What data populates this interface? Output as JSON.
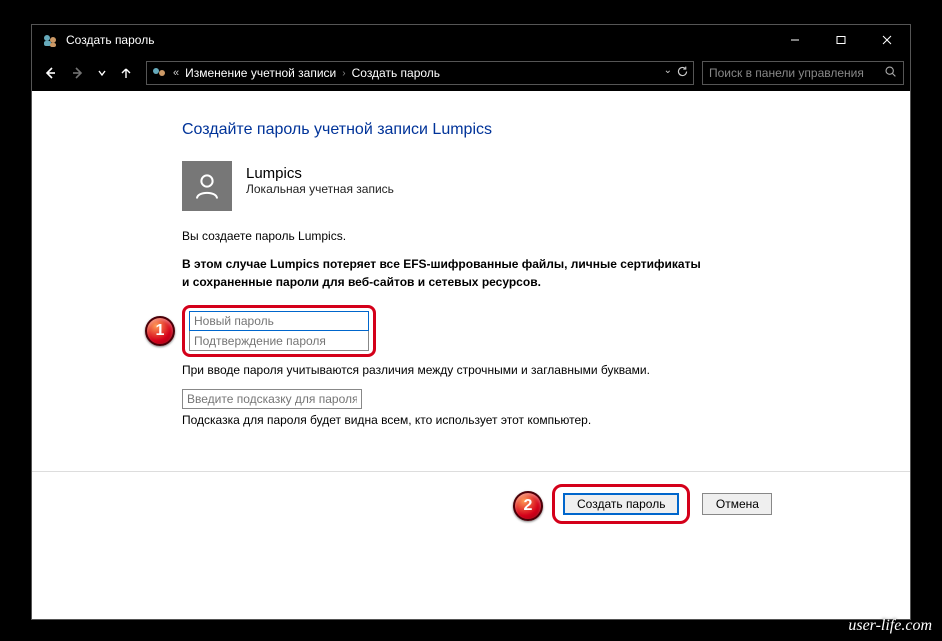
{
  "window": {
    "title": "Создать пароль"
  },
  "breadcrumb": {
    "item1": "Изменение учетной записи",
    "item2": "Создать пароль"
  },
  "search": {
    "placeholder": "Поиск в панели управления"
  },
  "page": {
    "heading": "Создайте пароль учетной записи Lumpics",
    "user_name": "Lumpics",
    "user_type": "Локальная учетная запись",
    "info": "Вы создаете пароль Lumpics.",
    "warning": "В этом случае Lumpics потеряет все EFS-шифрованные файлы, личные сертификаты и сохраненные пароли для веб-сайтов и сетевых ресурсов.",
    "new_password_placeholder": "Новый пароль",
    "confirm_password_placeholder": "Подтверждение пароля",
    "case_note": "При вводе пароля учитываются различия между строчными и заглавными буквами.",
    "hint_placeholder": "Введите подсказку для пароля",
    "hint_note": "Подсказка для пароля будет видна всем, кто использует этот компьютер."
  },
  "buttons": {
    "primary": "Создать пароль",
    "cancel": "Отмена"
  },
  "annotations": {
    "badge1": "1",
    "badge2": "2"
  },
  "watermark": "user-life.com"
}
